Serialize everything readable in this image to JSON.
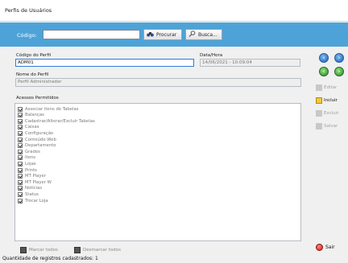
{
  "window": {
    "title": "Perfis de Usuários"
  },
  "search": {
    "label": "Código:",
    "value": "",
    "procurar_label": "Procurar",
    "busca_label": "Busca..."
  },
  "form": {
    "codigo_label": "Código do Perfil",
    "codigo_value": "ADM01",
    "datahora_label": "Data/Hora",
    "datahora_value": "14/06/2021 - 10:09:04",
    "nome_label": "Nome do Perfil",
    "nome_value": "Perfil Administrador",
    "acessos_label": "Acessos Permitidos"
  },
  "acessos": [
    "Associar itens de Tabelas",
    "Balanças",
    "Cadastrar/Alterar/Excluir Tabelas",
    "Caixas",
    "Configuração",
    "Conteúdo Web",
    "Departamento",
    "Grades",
    "Itens",
    "Lojas",
    "Prints",
    "MT Player",
    "MT Player W",
    "Notícias",
    "Status",
    "Trocar Loja"
  ],
  "bottom_buttons": {
    "marcar_todos": "Marcar todos",
    "desmarcar_todos": "Desmarcar todos"
  },
  "side_buttons": {
    "editar": "Editar",
    "incluir": "Incluir",
    "excluir": "Excluir",
    "salvar": "Salvar",
    "sair": "Sair"
  },
  "status": {
    "text": "Quantidade de registros cadastrados:  1"
  }
}
